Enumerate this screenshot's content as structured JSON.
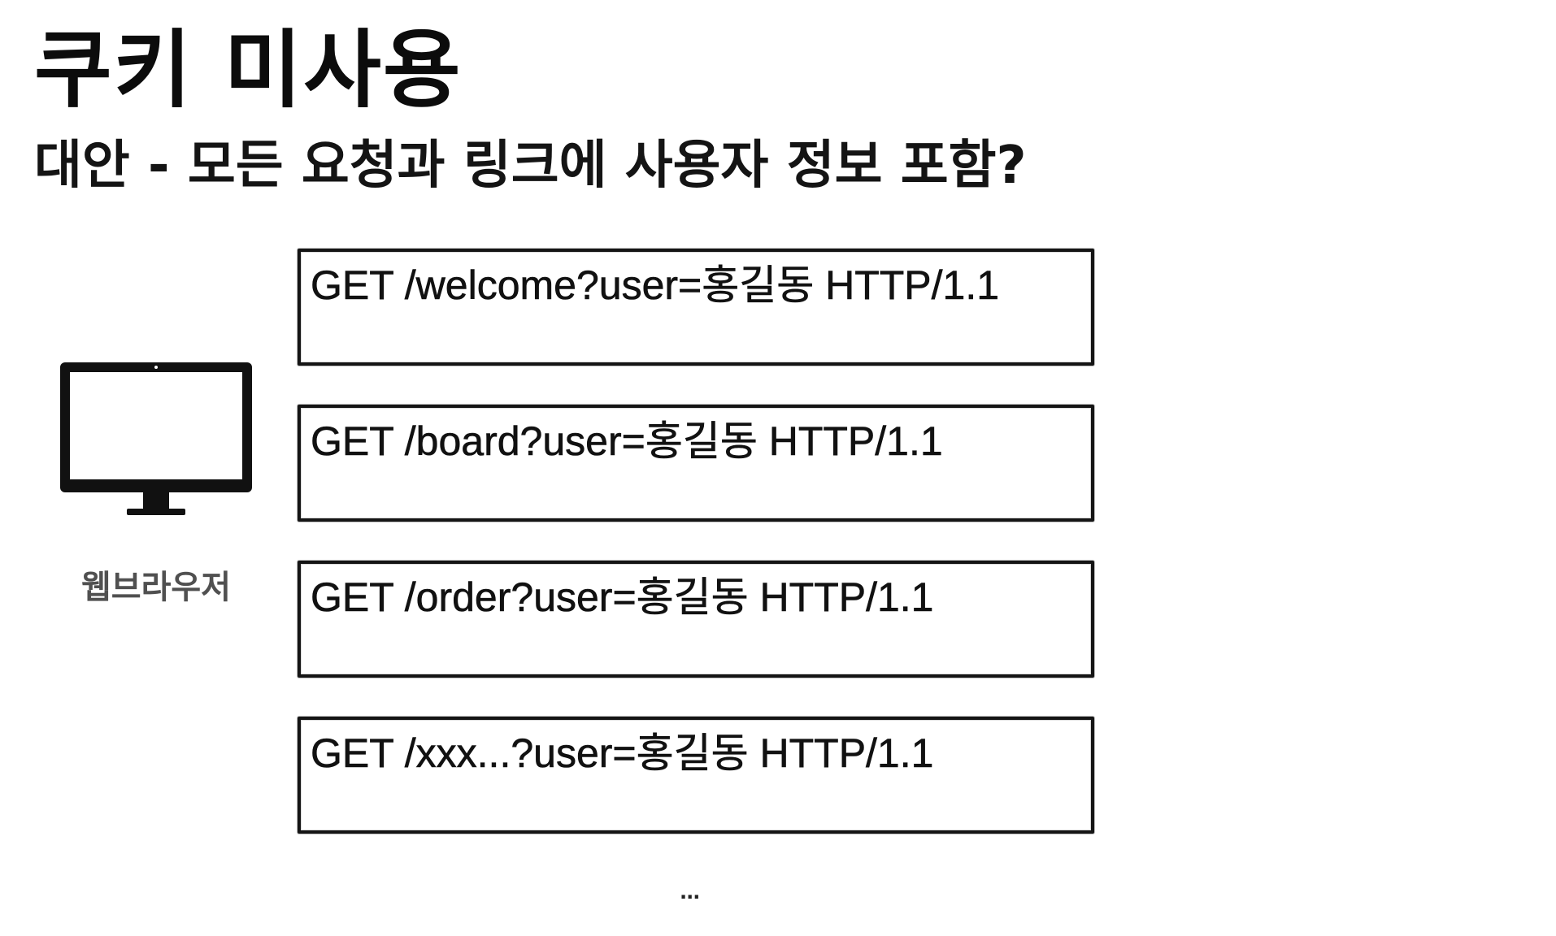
{
  "slide": {
    "title": "쿠키 미사용",
    "subtitle": "대안 - 모든 요청과 링크에 사용자 정보 포함?"
  },
  "browser": {
    "label": "웹브라우저",
    "icon": "monitor-icon"
  },
  "requests": [
    {
      "text": "GET /welcome?user=홍길동 HTTP/1.1"
    },
    {
      "text": "GET /board?user=홍길동 HTTP/1.1"
    },
    {
      "text": "GET /order?user=홍길동 HTTP/1.1"
    },
    {
      "text": "GET /xxx...?user=홍길동 HTTP/1.1"
    }
  ],
  "more": "..."
}
